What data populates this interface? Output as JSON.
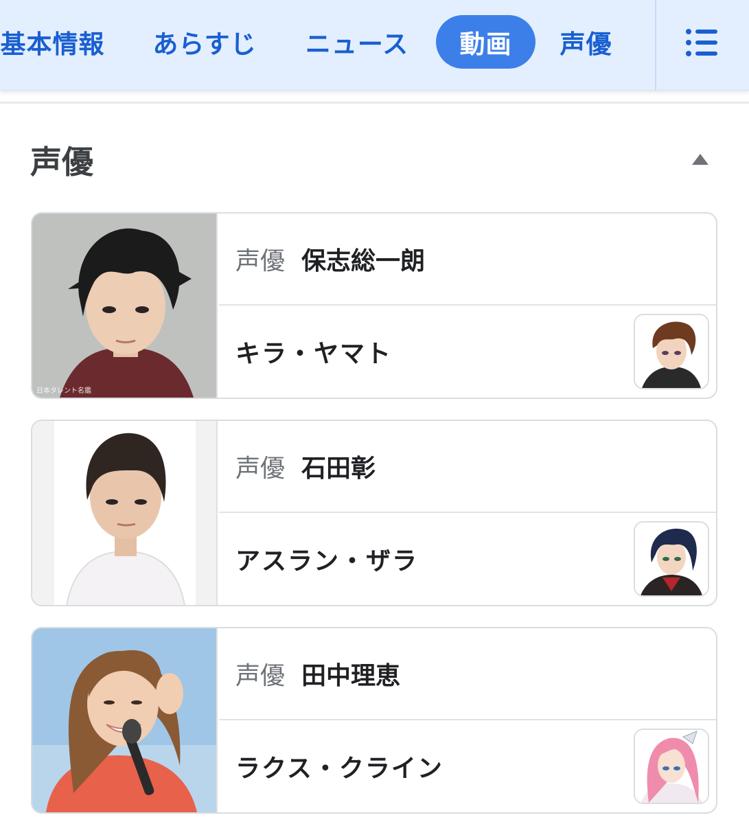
{
  "tabs": [
    {
      "label": "基本情報",
      "active": false
    },
    {
      "label": "あらすじ",
      "active": false
    },
    {
      "label": "ニュース",
      "active": false
    },
    {
      "label": "動画",
      "active": true
    },
    {
      "label": "声優",
      "active": false
    }
  ],
  "menu_icon": "list-menu-icon",
  "section": {
    "title": "声優",
    "collapse_icon": "triangle-up-icon"
  },
  "cast": [
    {
      "role_label": "声優",
      "actor": "保志総一朗",
      "character": "キラ・ヤマト",
      "photo_credit": "日本タレント名鑑"
    },
    {
      "role_label": "声優",
      "actor": "石田彰",
      "character": "アスラン・ザラ"
    },
    {
      "role_label": "声優",
      "actor": "田中理恵",
      "character": "ラクス・クライン"
    }
  ],
  "colors": {
    "accent": "#3d7fe8",
    "tab_text": "#1a5fd0",
    "tabbar_bg": "#e3efff"
  }
}
